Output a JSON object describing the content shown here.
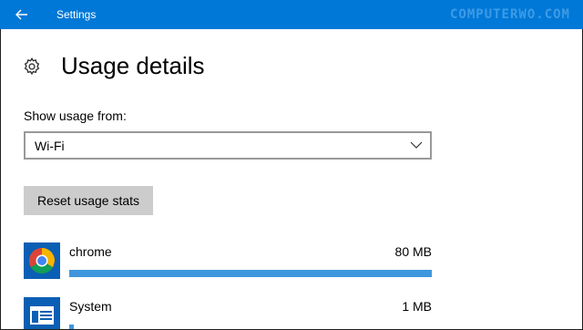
{
  "window": {
    "title": "Settings",
    "accent_color": "#0078d7"
  },
  "watermark": "COMPUTERWO.COM",
  "page": {
    "title": "Usage details",
    "icon": "gear-icon"
  },
  "usage_source": {
    "label": "Show usage from:",
    "selected": "Wi-Fi"
  },
  "reset_button": {
    "label": "Reset usage stats"
  },
  "apps": [
    {
      "name": "chrome",
      "size": "80 MB",
      "icon": "chrome-icon",
      "usage_fraction": 1.0
    },
    {
      "name": "System",
      "size": "1 MB",
      "icon": "system-icon",
      "usage_fraction": 0.0125
    }
  ]
}
